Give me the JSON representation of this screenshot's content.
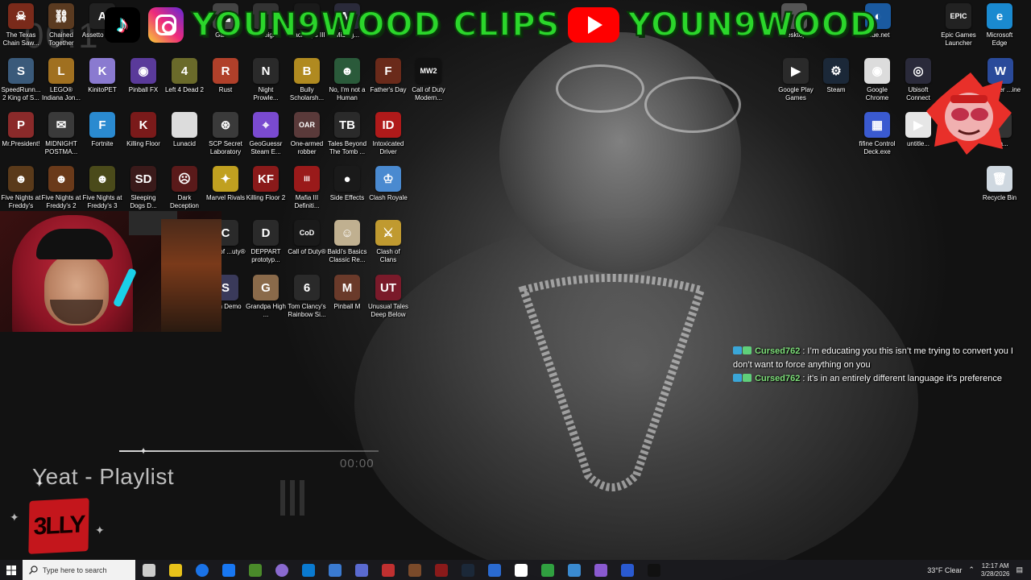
{
  "banner": {
    "left_text": "YOUN9WOOD CLIPS",
    "right_text": "YOUN9WOOD",
    "icons": [
      "tiktok-icon",
      "instagram-icon",
      "youtube-icon"
    ]
  },
  "clock_overlay": "00:1",
  "desktop_icons": [
    {
      "label": "The Texas Chain Saw...",
      "color": "#7a2a1a",
      "glyph": "☠"
    },
    {
      "label": "Chained Together",
      "color": "#5a3a20",
      "glyph": "⛓"
    },
    {
      "label": "Assetto Corsa",
      "color": "#222",
      "glyph": "A"
    },
    {
      "label": "Games",
      "color": "#444",
      "glyph": "▦"
    },
    {
      "label": "Spotlight",
      "color": "#333",
      "glyph": "◐"
    },
    {
      "label": "Black Ops III",
      "color": "#1a1a1a",
      "glyph": "III"
    },
    {
      "label": "Midnig...",
      "color": "#2a2a3a",
      "glyph": "M"
    },
    {
      "label": "SpeedRunn... 2 King of S...",
      "color": "#3a5a7a",
      "glyph": "S"
    },
    {
      "label": "LEGO® Indiana Jon...",
      "color": "#a07020",
      "glyph": "L"
    },
    {
      "label": "KinitoPET",
      "color": "#8a7ad0",
      "glyph": "K"
    },
    {
      "label": "Pinball FX",
      "color": "#5a3a9a",
      "glyph": "◉"
    },
    {
      "label": "Left 4 Dead 2",
      "color": "#6a6a2a",
      "glyph": "4"
    },
    {
      "label": "Rust",
      "color": "#b0402a",
      "glyph": "R"
    },
    {
      "label": "Night Prowle...",
      "color": "#2a2a2a",
      "glyph": "N"
    },
    {
      "label": "Bully Scholarsh...",
      "color": "#b08a20",
      "glyph": "B"
    },
    {
      "label": "No, I'm not a Human",
      "color": "#2a5a3a",
      "glyph": "☻"
    },
    {
      "label": "Father's Day",
      "color": "#6a2a1a",
      "glyph": "F"
    },
    {
      "label": "Call of Duty Modern...",
      "color": "#111",
      "glyph": "MW2"
    },
    {
      "label": "Mr.President!",
      "color": "#8a2a2a",
      "glyph": "P"
    },
    {
      "label": "MIDNIGHT POSTMA...",
      "color": "#3a3a3a",
      "glyph": "✉"
    },
    {
      "label": "Fortnite",
      "color": "#2a8ad0",
      "glyph": "F"
    },
    {
      "label": "Killing Floor",
      "color": "#7a1a1a",
      "glyph": "K"
    },
    {
      "label": "Lunacid",
      "color": "#dcdcdc",
      "glyph": ""
    },
    {
      "label": "SCP Secret Laboratory",
      "color": "#3a3a3a",
      "glyph": "⊛"
    },
    {
      "label": "GeoGuessr Steam E...",
      "color": "#7a4ad0",
      "glyph": "⌖"
    },
    {
      "label": "One-armed robber",
      "color": "#5a3a3a",
      "glyph": "OAR"
    },
    {
      "label": "Tales Beyond The Tomb ...",
      "color": "#2a2a2a",
      "glyph": "TB"
    },
    {
      "label": "Intoxicated Driver",
      "color": "#b01a1a",
      "glyph": "ID"
    },
    {
      "label": "Five Nights at Freddy's",
      "color": "#5a3a1a",
      "glyph": "☻"
    },
    {
      "label": "Five Nights at Freddy's 2",
      "color": "#6a3a1a",
      "glyph": "☻"
    },
    {
      "label": "Five Nights at Freddy's 3",
      "color": "#4a4a1a",
      "glyph": "☻"
    },
    {
      "label": "Sleeping Dogs D...",
      "color": "#3a1a1a",
      "glyph": "SD"
    },
    {
      "label": "Dark Deception",
      "color": "#5a1a1a",
      "glyph": "☹"
    },
    {
      "label": "Marvel Rivals",
      "color": "#c0a020",
      "glyph": "✦"
    },
    {
      "label": "Killing Floor 2",
      "color": "#8a1a1a",
      "glyph": "KF"
    },
    {
      "label": "Mafia III Definiti...",
      "color": "#9a1a1a",
      "glyph": "III"
    },
    {
      "label": "Side Effects",
      "color": "#1a1a1a",
      "glyph": "●"
    },
    {
      "label": "Clash Royale",
      "color": "#4a8ad0",
      "glyph": "♔"
    },
    {
      "label": "...all of ...uty®",
      "color": "#2a2a2a",
      "glyph": "C"
    },
    {
      "label": "DEPPART prototyp...",
      "color": "#2a2a2a",
      "glyph": "D"
    },
    {
      "label": "Call of Duty®",
      "color": "#1a1a1a",
      "glyph": "CoD"
    },
    {
      "label": "Baldi's Basics Classic Re...",
      "color": "#c0b090",
      "glyph": "☺"
    },
    {
      "label": "Clash of Clans",
      "color": "#c09a30",
      "glyph": "⚔"
    },
    {
      "label": "Skin Demo",
      "color": "#3a3a5a",
      "glyph": "S"
    },
    {
      "label": "Grandpa High ...",
      "color": "#8a6a4a",
      "glyph": "G"
    },
    {
      "label": "Tom Clancy's Rainbow Si...",
      "color": "#2a2a2a",
      "glyph": "6"
    },
    {
      "label": "Pinball M",
      "color": "#6a3a2a",
      "glyph": "M"
    },
    {
      "label": "Unusual Tales Deep Below",
      "color": "#7a1a2a",
      "glyph": "UT"
    }
  ],
  "right_icons": [
    {
      "label": "...de.net",
      "color": "#1a5aa0",
      "glyph": "◐"
    },
    {
      "label": "Epic Games Launcher",
      "color": "#222",
      "glyph": "EPIC"
    },
    {
      "label": "Microsoft Edge",
      "color": "#1a8ad0",
      "glyph": "e"
    },
    {
      "label": "Google Play Games",
      "color": "#2a2a2a",
      "glyph": "▶"
    },
    {
      "label": "Steam",
      "color": "#1b2838",
      "glyph": "⚙"
    },
    {
      "label": "Google Chrome",
      "color": "#dcdcdc",
      "glyph": "◉"
    },
    {
      "label": "Ubisoft Connect",
      "color": "#2a2a3a",
      "glyph": "◎"
    },
    {
      "label": "...llpaper ...ine",
      "color": "#2a4a9a",
      "glyph": "W"
    },
    {
      "label": "fifine Control Deck.exe",
      "color": "#3a5ad0",
      "glyph": "▦"
    },
    {
      "label": "untitle...",
      "color": "#e6e6e6",
      "glyph": "▶"
    },
    {
      "label": "...wa...",
      "color": "#333",
      "glyph": ""
    },
    {
      "label": "Recycle Bin",
      "color": "#cfd8e0",
      "glyph": "🗑"
    },
    {
      "label": "Desktop",
      "color": "#555",
      "glyph": ""
    }
  ],
  "chat": [
    {
      "user": "Cursed762",
      "message": "I’m educating you this isn’t me trying to convert you I don’t want to force anything on you"
    },
    {
      "user": "Cursed762",
      "message": "it’s in an entirely different language it’s preference"
    }
  ],
  "player": {
    "track_title": "Yeat - Playlist",
    "time": "00:00",
    "logo_text": "3LLY"
  },
  "taskbar": {
    "search_placeholder": "Type here to search",
    "apps": [
      "files-icon",
      "chrome-icon",
      "facebook-icon",
      "minecraft-icon",
      "copilot-icon",
      "edge-icon",
      "store-icon",
      "mail-icon",
      "app-icon",
      "box-icon",
      "app-icon",
      "steam-icon",
      "outlook-icon",
      "notepad-icon",
      "app-icon",
      "app-icon",
      "xbox-icon",
      "messenger-icon",
      "app-icon",
      "mw2-icon"
    ],
    "weather": "33°F  Clear",
    "time": "12:17 AM",
    "date": "3/28/2026"
  }
}
